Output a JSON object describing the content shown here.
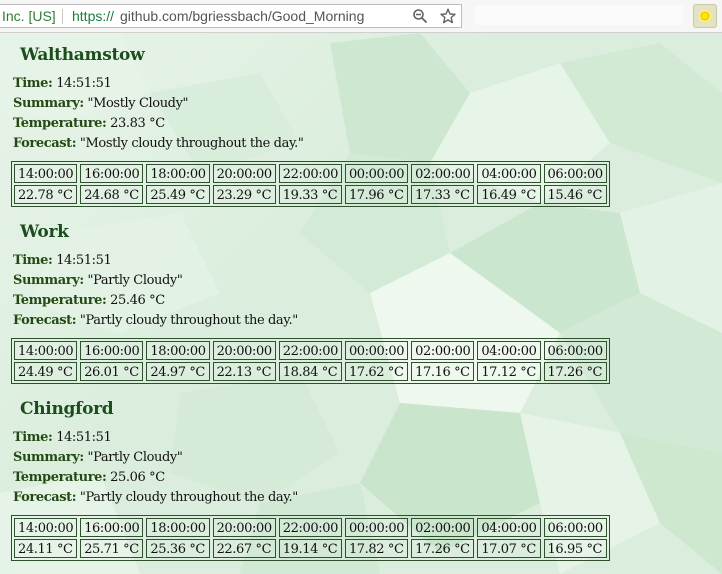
{
  "browser": {
    "secure_label": "Inc. [US]",
    "url_protocol": "https://",
    "url_rest": "github.com/bgriessbach/Good_Morning"
  },
  "locations": [
    {
      "name": "Walthamstow",
      "time_label": "Time:",
      "time": "14:51:51",
      "summary_label": "Summary:",
      "summary": "\"Mostly Cloudy\"",
      "temperature_label": "Temperature:",
      "temperature": "23.83 °C",
      "forecast_label": "Forecast:",
      "forecast": "\"Mostly cloudy throughout the day.\"",
      "hours": [
        "14:00:00",
        "16:00:00",
        "18:00:00",
        "20:00:00",
        "22:00:00",
        "00:00:00",
        "02:00:00",
        "04:00:00",
        "06:00:00"
      ],
      "temps": [
        "22.78 °C",
        "24.68 °C",
        "25.49 °C",
        "23.29 °C",
        "19.33 °C",
        "17.96 °C",
        "17.33 °C",
        "16.49 °C",
        "15.46 °C"
      ]
    },
    {
      "name": "Work",
      "time_label": "Time:",
      "time": "14:51:51",
      "summary_label": "Summary:",
      "summary": "\"Partly Cloudy\"",
      "temperature_label": "Temperature:",
      "temperature": "25.46 °C",
      "forecast_label": "Forecast:",
      "forecast": "\"Partly cloudy throughout the day.\"",
      "hours": [
        "14:00:00",
        "16:00:00",
        "18:00:00",
        "20:00:00",
        "22:00:00",
        "00:00:00",
        "02:00:00",
        "04:00:00",
        "06:00:00"
      ],
      "temps": [
        "24.49 °C",
        "26.01 °C",
        "24.97 °C",
        "22.13 °C",
        "18.84 °C",
        "17.62 °C",
        "17.16 °C",
        "17.12 °C",
        "17.26 °C"
      ]
    },
    {
      "name": "Chingford",
      "time_label": "Time:",
      "time": "14:51:51",
      "summary_label": "Summary:",
      "summary": "\"Partly Cloudy\"",
      "temperature_label": "Temperature:",
      "temperature": "25.06 °C",
      "forecast_label": "Forecast:",
      "forecast": "\"Partly cloudy throughout the day.\"",
      "hours": [
        "14:00:00",
        "16:00:00",
        "18:00:00",
        "20:00:00",
        "22:00:00",
        "00:00:00",
        "02:00:00",
        "04:00:00",
        "06:00:00"
      ],
      "temps": [
        "24.11 °C",
        "25.71 °C",
        "25.36 °C",
        "22.67 °C",
        "19.14 °C",
        "17.82 °C",
        "17.26 °C",
        "17.07 °C",
        "16.95 °C"
      ]
    }
  ],
  "colors": {
    "title": "#1c4d1c",
    "label": "#244a14",
    "background": "#dbeedd",
    "border": "#2f4f2f",
    "secure": "#2e7d32"
  },
  "icons": {
    "zoom": "zoom-out-icon",
    "bookmark": "star-icon",
    "extension": "sun-icon"
  }
}
